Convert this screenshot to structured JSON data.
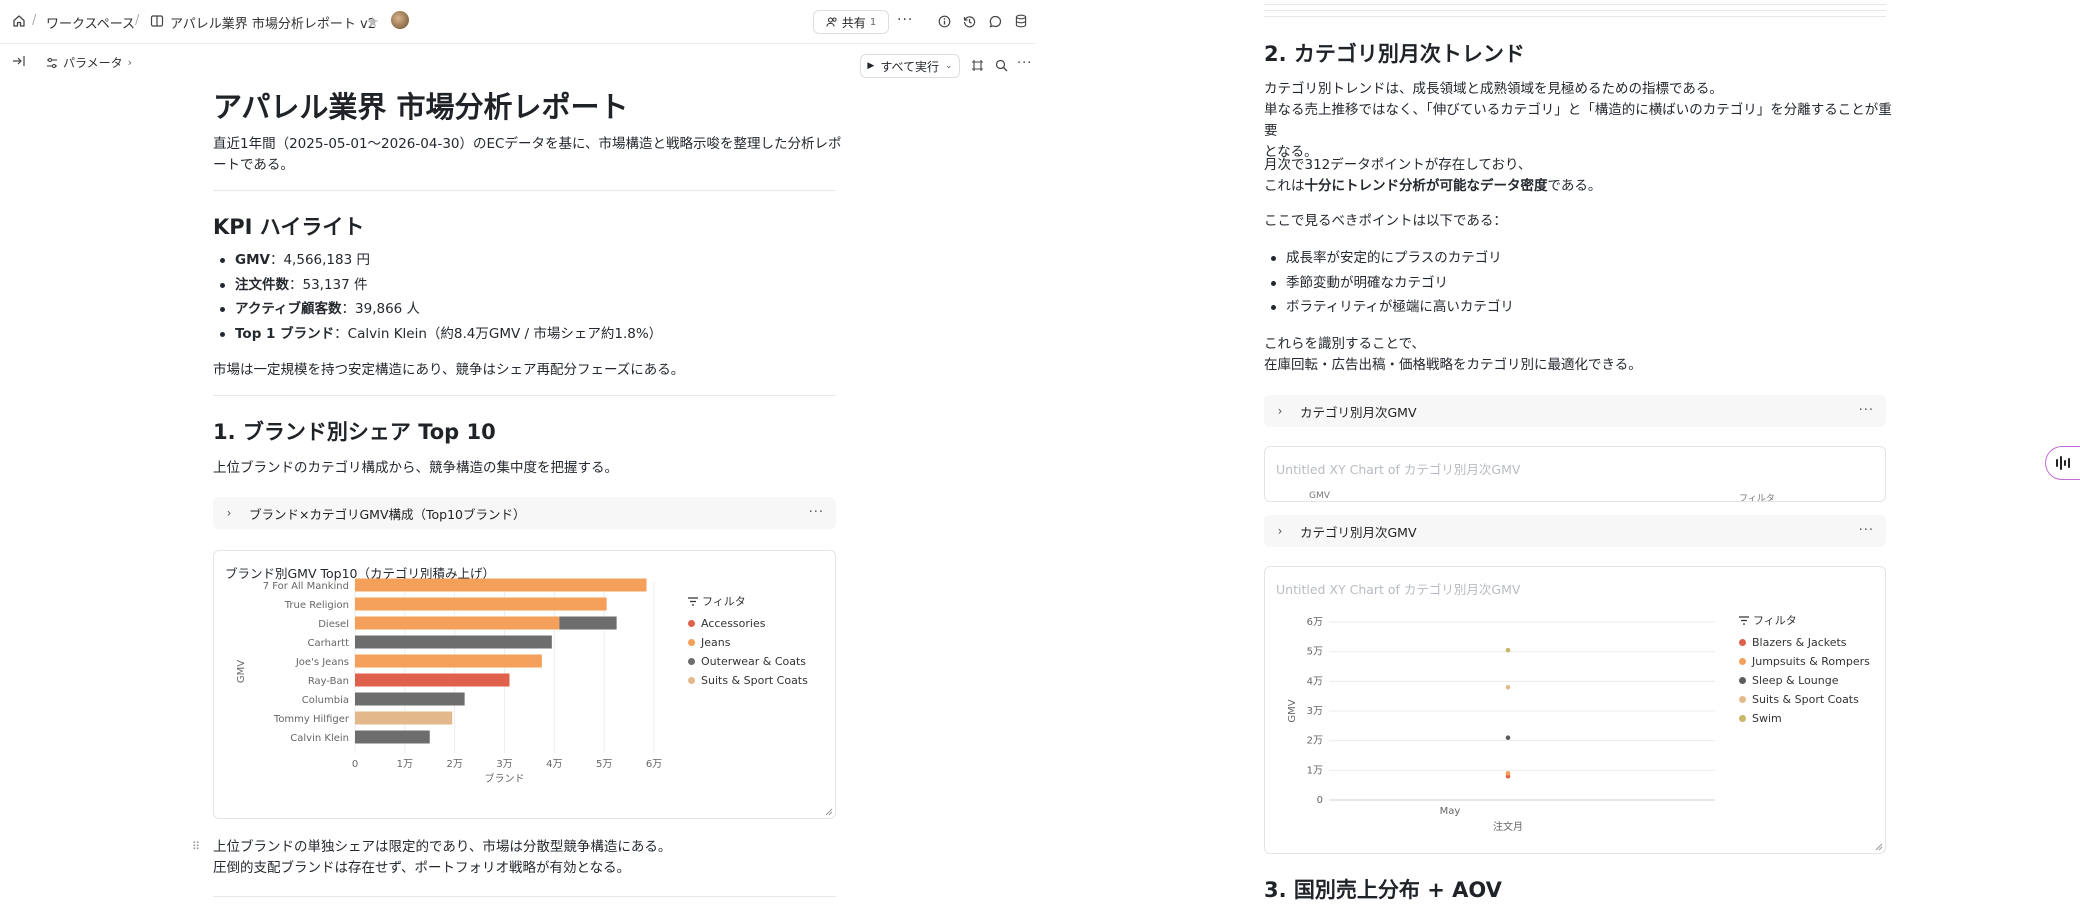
{
  "topbar": {
    "workspace": "ワークスペース",
    "doc_title": "アパレル業界 市場分析レポート v2",
    "share_label": "共有",
    "share_count": "1",
    "params_label": "パラメータ",
    "run_all_label": "すべて実行"
  },
  "doc": {
    "title": "アパレル業界 市場分析レポート",
    "intro_l1": "直近1年間（2025-05-01〜2026-04-30）のECデータを基に、市場構造と戦略示唆を整理した分析レポ",
    "intro_l2": "ートである。",
    "kpi_heading": "KPI ハイライト",
    "kpi": [
      {
        "label": "GMV",
        "value": "：4,566,183 円"
      },
      {
        "label": "注文件数",
        "value": "：53,137 件"
      },
      {
        "label": "アクティブ顧客数",
        "value": "：39,866 人"
      },
      {
        "label": "Top 1 ブランド",
        "value": "：Calvin Klein（約8.4万GMV / 市場シェア約1.8%）"
      }
    ],
    "kpi_summary": "市場は一定規模を持つ安定構造にあり、競争はシェア再配分フェーズにある。",
    "s1_heading": "1. ブランド別シェア Top 10",
    "s1_desc": "上位ブランドのカテゴリ構成から、競争構造の集中度を把握する。",
    "s1_accordion": "ブランド×カテゴリGMV構成（Top10ブランド）",
    "s1_chart_title": "ブランド別GMV Top10（カテゴリ別積み上げ）",
    "s1_after_l1": "上位ブランドの単独シェアは限定的であり、市場は分散型競争構造にある。",
    "s1_after_l2": "圧倒的支配ブランドは存在せず、ポートフォリオ戦略が有効となる。",
    "s2_heading": "2. カテゴリ別月次トレンド",
    "s2_p1_l1": "カテゴリ別トレンドは、成長領域と成熟領域を見極めるための指標である。",
    "s2_p1_l2": "単なる売上推移ではなく、「伸びているカテゴリ」と「構造的に横ばいのカテゴリ」を分離することが重要",
    "s2_p1_l3": "となる。",
    "s2_p2_l1": "月次で312データポイントが存在しており、",
    "s2_p2_l2_pre": "これは",
    "s2_p2_l2_bold": "十分にトレンド分析が可能なデータ密度",
    "s2_p2_l2_post": "である。",
    "s2_p3": "ここで見るべきポイントは以下である：",
    "s2_points": [
      "成長率が安定的にプラスのカテゴリ",
      "季節変動が明確なカテゴリ",
      "ボラティリティが極端に高いカテゴリ"
    ],
    "s2_p4_l1": "これらを識別することで、",
    "s2_p4_l2": "在庫回転・広告出稿・価格戦略をカテゴリ別に最適化できる。",
    "s2_accordion": "カテゴリ別月次GMV",
    "s2_chart_title": "Untitled XY Chart of カテゴリ別月次GMV",
    "s2_clip_left": "GMV",
    "s2_clip_right": "フィルタ",
    "s3_heading": "3. 国別売上分布 + AOV"
  },
  "legend_filter_label": "フィルタ",
  "colors": {
    "Accessories": "#e0614b",
    "Jeans": "#f5a05a",
    "Outerwear & Coats": "#6d6d6d",
    "Suits & Sport Coats": "#e3b98b",
    "Blazers & Jackets": "#e0614b",
    "Jumpsuits & Rompers": "#f5a05a",
    "Sleep & Lounge": "#5d5d5d",
    "Swim": "#c8b764"
  },
  "chart_data": [
    {
      "type": "bar",
      "orientation": "horizontal",
      "stacked": true,
      "title": "ブランド別GMV Top10（カテゴリ別積み上げ）",
      "xlabel": "ブランド",
      "ylabel": "GMV",
      "xlim": [
        0,
        60000
      ],
      "x_ticks": [
        0,
        10000,
        20000,
        30000,
        40000,
        50000,
        60000
      ],
      "x_tick_labels": [
        "0",
        "1万",
        "2万",
        "3万",
        "4万",
        "5万",
        "6万"
      ],
      "categories": [
        "7 For All Mankind",
        "True Religion",
        "Diesel",
        "Carhartt",
        "Joe's Jeans",
        "Ray-Ban",
        "Columbia",
        "Tommy Hilfiger",
        "Calvin Klein"
      ],
      "series": [
        {
          "name": "Accessories",
          "values": [
            0,
            0,
            0,
            0,
            0,
            31000,
            0,
            0,
            0
          ]
        },
        {
          "name": "Jeans",
          "values": [
            58500,
            50500,
            41000,
            0,
            37500,
            0,
            0,
            0,
            0
          ]
        },
        {
          "name": "Outerwear & Coats",
          "values": [
            0,
            0,
            11500,
            39500,
            0,
            0,
            22000,
            0,
            15000
          ]
        },
        {
          "name": "Suits & Sport Coats",
          "values": [
            0,
            0,
            0,
            0,
            0,
            0,
            0,
            19500,
            0
          ]
        }
      ],
      "legend": "right"
    },
    {
      "type": "scatter",
      "title": "Untitled XY Chart of カテゴリ別月次GMV",
      "xlabel": "注文月",
      "ylabel": "GMV",
      "ylim": [
        0,
        60000
      ],
      "y_ticks": [
        0,
        10000,
        20000,
        30000,
        40000,
        50000,
        60000
      ],
      "y_tick_labels": [
        "0",
        "1万",
        "2万",
        "3万",
        "4万",
        "5万",
        "6万"
      ],
      "x_tick_labels": [
        "May"
      ],
      "series": [
        {
          "name": "Blazers & Jackets",
          "points": [
            {
              "x": "2025-05",
              "y": 8000
            }
          ]
        },
        {
          "name": "Jumpsuits & Rompers",
          "points": [
            {
              "x": "2025-05",
              "y": 9000
            }
          ]
        },
        {
          "name": "Sleep & Lounge",
          "points": [
            {
              "x": "2025-05",
              "y": 21000
            }
          ]
        },
        {
          "name": "Suits & Sport Coats",
          "points": [
            {
              "x": "2025-05",
              "y": 38000
            }
          ]
        },
        {
          "name": "Swim",
          "points": [
            {
              "x": "2025-05",
              "y": 50500
            }
          ]
        }
      ],
      "legend": "right"
    }
  ]
}
